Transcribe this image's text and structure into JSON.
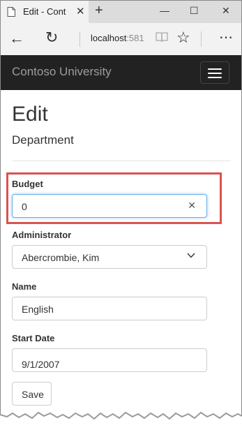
{
  "browser": {
    "tab_title": "Edit - Cont",
    "new_tab_symbol": "+",
    "url_host": "localhost",
    "url_port": ":581",
    "window_controls": [
      "—",
      "☐",
      "✕"
    ]
  },
  "navbar": {
    "brand": "Contoso University"
  },
  "page": {
    "heading": "Edit",
    "subheading": "Department"
  },
  "form": {
    "budget_label": "Budget",
    "budget_value": "0",
    "administrator_label": "Administrator",
    "administrator_value": "Abercrombie, Kim",
    "name_label": "Name",
    "name_value": "English",
    "start_date_label": "Start Date",
    "start_date_value": "9/1/2007",
    "save_label": "Save"
  },
  "colors": {
    "navbar_bg": "#222222",
    "highlight_border": "#d9534f",
    "focus_border": "#66afe9"
  }
}
